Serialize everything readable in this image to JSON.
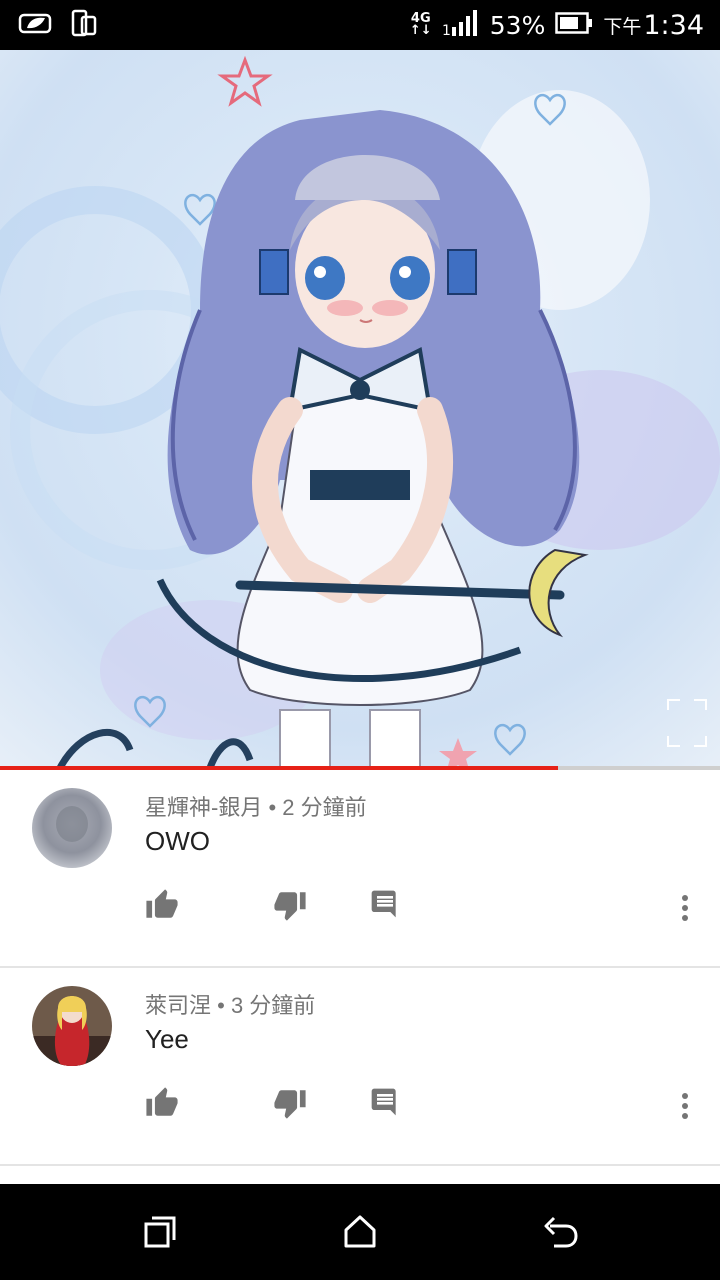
{
  "status_bar": {
    "network": "4G",
    "battery_percent": "53%",
    "time_prefix": "下午",
    "time": "1:34",
    "icons": [
      "leaf-notification-icon",
      "phone-rotate-icon",
      "network-4g-icon",
      "signal-icon",
      "battery-icon"
    ]
  },
  "video": {
    "progress": 0.775,
    "accent_color": "#e62117",
    "thumbnail": "anime-girl-illustration"
  },
  "comments": [
    {
      "author": "星輝神-銀月",
      "time": "2 分鐘前",
      "text": "OWO",
      "meta_sep": " • "
    },
    {
      "author": "萊司涅",
      "time": "3 分鐘前",
      "text": "Yee",
      "meta_sep": " • "
    }
  ],
  "nav_bar": {
    "icons": [
      "recent-apps-icon",
      "home-icon",
      "back-icon"
    ]
  }
}
